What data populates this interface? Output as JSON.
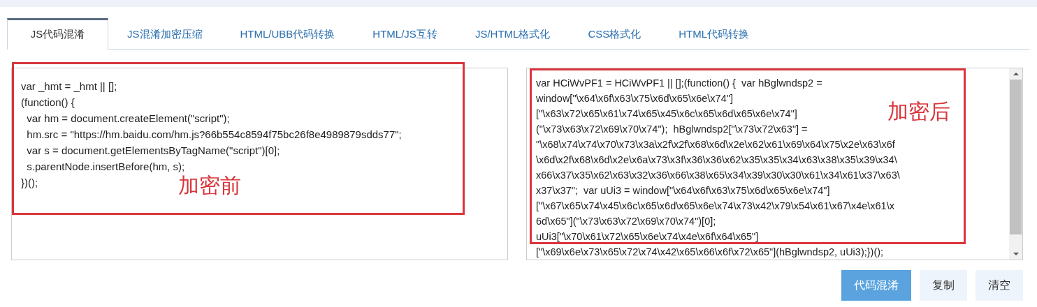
{
  "tabs": [
    {
      "label": "JS代码混淆",
      "selected": true
    },
    {
      "label": "JS混淆加密压缩",
      "selected": false
    },
    {
      "label": "HTML/UBB代码转换",
      "selected": false
    },
    {
      "label": "HTML/JS互转",
      "selected": false
    },
    {
      "label": "JS/HTML格式化",
      "selected": false
    },
    {
      "label": "CSS格式化",
      "selected": false
    },
    {
      "label": "HTML代码转换",
      "selected": false
    }
  ],
  "input_code": {
    "lines": [
      "var _hmt = _hmt || [];",
      "(function() {",
      "  var hm = document.createElement(\"script\");",
      "  hm.src = \"https://hm.baidu.com/hm.js?66b554c8594f75bc26f8e4989879sdds77\";",
      "  var s = document.getElementsByTagName(\"script\")[0];",
      "  s.parentNode.insertBefore(hm, s);",
      "})();"
    ],
    "annotation": "加密前"
  },
  "output_code": {
    "lines": [
      "var HCiWvPF1 = HCiWvPF1 || [];(function() {  var hBglwndsp2 =",
      "window[\"\\x64\\x6f\\x63\\x75\\x6d\\x65\\x6e\\x74\"]",
      "[\"\\x63\\x72\\x65\\x61\\x74\\x65\\x45\\x6c\\x65\\x6d\\x65\\x6e\\x74\"]",
      "(\"\\x73\\x63\\x72\\x69\\x70\\x74\");  hBglwndsp2[\"\\x73\\x72\\x63\"] =",
      "\"\\x68\\x74\\x74\\x70\\x73\\x3a\\x2f\\x2f\\x68\\x6d\\x2e\\x62\\x61\\x69\\x64\\x75\\x2e\\x63\\x6f",
      "\\x6d\\x2f\\x68\\x6d\\x2e\\x6a\\x73\\x3f\\x36\\x36\\x62\\x35\\x35\\x34\\x63\\x38\\x35\\x39\\x34\\",
      "x66\\x37\\x35\\x62\\x63\\x32\\x36\\x66\\x38\\x65\\x34\\x39\\x30\\x30\\x61\\x34\\x61\\x37\\x63\\",
      "x37\\x37\";  var uUi3 = window[\"\\x64\\x6f\\x63\\x75\\x6d\\x65\\x6e\\x74\"]",
      "[\"\\x67\\x65\\x74\\x45\\x6c\\x65\\x6d\\x65\\x6e\\x74\\x73\\x42\\x79\\x54\\x61\\x67\\x4e\\x61\\x",
      "6d\\x65\"](\"\\x73\\x63\\x72\\x69\\x70\\x74\")[0];",
      "uUi3[\"\\x70\\x61\\x72\\x65\\x6e\\x74\\x4e\\x6f\\x64\\x65\"]",
      "[\"\\x69\\x6e\\x73\\x65\\x72\\x74\\x42\\x65\\x66\\x6f\\x72\\x65\"](hBglwndsp2, uUi3);})();"
    ],
    "annotation": "加密后"
  },
  "buttons": [
    {
      "label": "代码混淆",
      "kind": "primary"
    },
    {
      "label": "复制",
      "kind": "plain"
    },
    {
      "label": "清空",
      "kind": "plain"
    }
  ]
}
